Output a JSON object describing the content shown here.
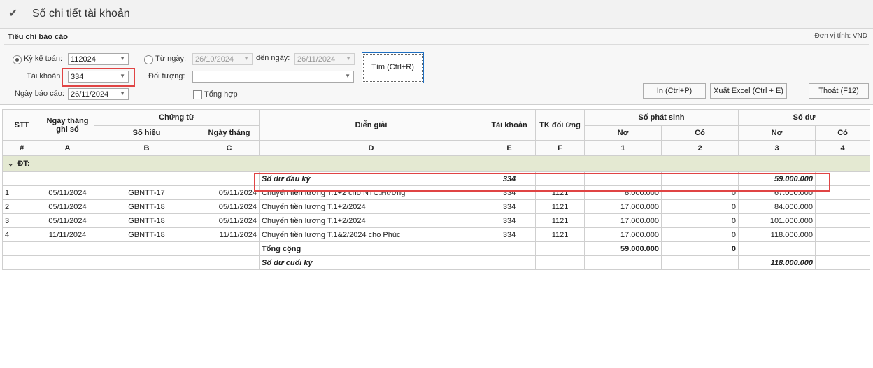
{
  "window": {
    "title": "Sổ chi tiết tài khoản"
  },
  "criteria": {
    "header": "Tiêu chí báo cáo",
    "unit": "Đơn vị tính: VND",
    "period_label": "Kỳ kế toán:",
    "period_value": "112024",
    "from_label": "Từ ngày:",
    "from_value": "26/10/2024",
    "to_label": "đến ngày:",
    "to_value": "26/11/2024",
    "account_label": "Tài khoản",
    "account_value": "334",
    "object_label": "Đối tượng:",
    "object_value": "",
    "report_date_label": "Ngày báo cáo:",
    "report_date_value": "26/11/2024",
    "summary_label": "Tổng hợp",
    "find_button": "Tìm  (Ctrl+R)",
    "print_button": "In  (Ctrl+P)",
    "excel_button": "Xuất Excel  (Ctrl + E)",
    "exit_button": "Thoát  (F12)"
  },
  "table": {
    "headers": {
      "stt": "STT",
      "date_recorded": "Ngày tháng ghi sổ",
      "voucher": "Chứng từ",
      "voucher_no": "Số hiệu",
      "voucher_date": "Ngày tháng",
      "description": "Diễn giải",
      "account": "Tài khoản",
      "contra": "TK đối ứng",
      "arising": "Số phát sinh",
      "balance": "Số dư",
      "debit": "Nợ",
      "credit": "Có",
      "debit2": "Nợ",
      "credit2": "Có"
    },
    "codes": [
      "#",
      "A",
      "B",
      "C",
      "D",
      "E",
      "F",
      "1",
      "2",
      "3",
      "4"
    ],
    "group_label": "ĐT:",
    "opening": {
      "label": "Số dư đầu kỳ",
      "account": "334",
      "balance_debit": "59.000.000"
    },
    "rows": [
      {
        "stt": "1",
        "date": "05/11/2024",
        "no": "GBNTT-17",
        "vdate": "05/11/2024",
        "desc": "Chuyển tiền lương T.1+2 cho NTC.Hương",
        "acc": "334",
        "contra": "1121",
        "debit": "8.000.000",
        "credit": "0",
        "bal_debit": "67.000.000",
        "bal_credit": ""
      },
      {
        "stt": "2",
        "date": "05/11/2024",
        "no": "GBNTT-18",
        "vdate": "05/11/2024",
        "desc": "Chuyển tiền lương T.1+2/2024",
        "acc": "334",
        "contra": "1121",
        "debit": "17.000.000",
        "credit": "0",
        "bal_debit": "84.000.000",
        "bal_credit": ""
      },
      {
        "stt": "3",
        "date": "05/11/2024",
        "no": "GBNTT-18",
        "vdate": "05/11/2024",
        "desc": "Chuyển tiền lương T.1+2/2024",
        "acc": "334",
        "contra": "1121",
        "debit": "17.000.000",
        "credit": "0",
        "bal_debit": "101.000.000",
        "bal_credit": ""
      },
      {
        "stt": "4",
        "date": "11/11/2024",
        "no": "GBNTT-18",
        "vdate": "11/11/2024",
        "desc": "Chuyển tiền lương T.1&2/2024 cho Phúc",
        "acc": "334",
        "contra": "1121",
        "debit": "17.000.000",
        "credit": "0",
        "bal_debit": "118.000.000",
        "bal_credit": ""
      }
    ],
    "total": {
      "label": "Tổng cộng",
      "debit": "59.000.000",
      "credit": "0"
    },
    "closing": {
      "label": "Số dư cuối kỳ",
      "balance_debit": "118.000.000"
    }
  }
}
